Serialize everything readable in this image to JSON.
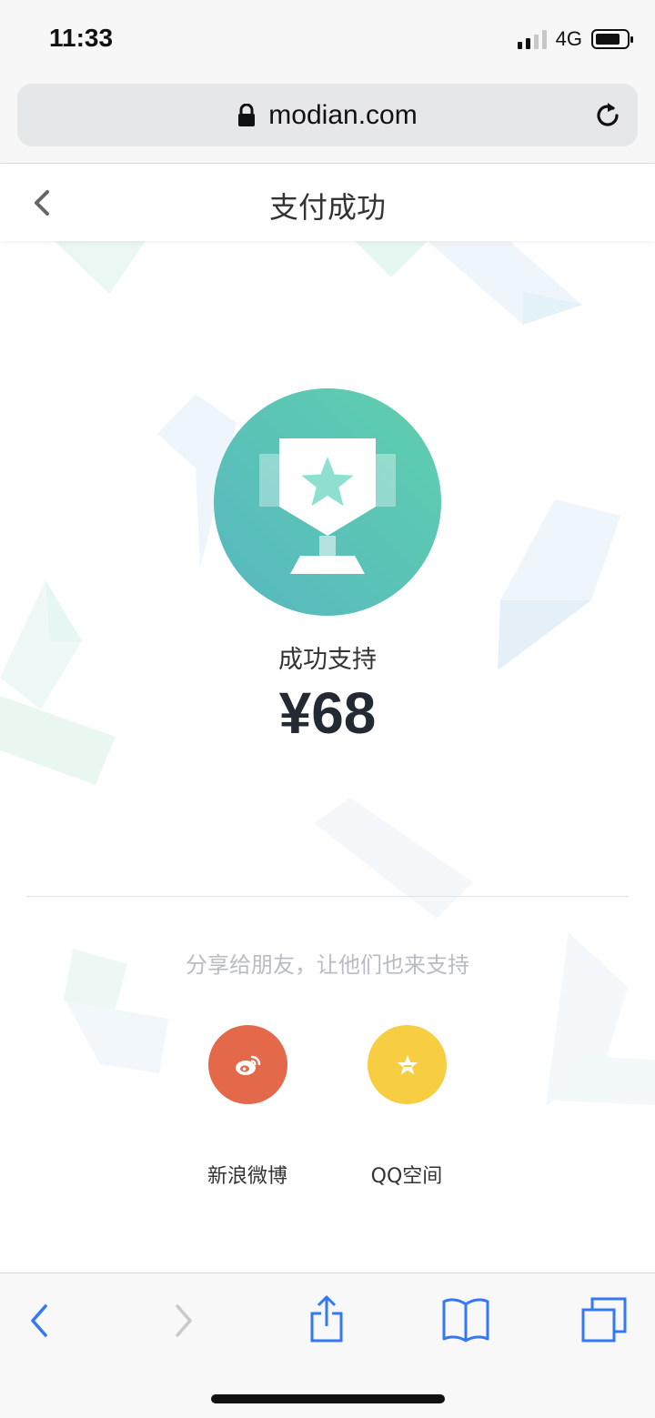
{
  "status": {
    "time": "11:33",
    "network": "4G"
  },
  "browser": {
    "url": "modian.com"
  },
  "header": {
    "title": "支付成功"
  },
  "main": {
    "success_label": "成功支持",
    "amount": "¥68",
    "share_hint": "分享给朋友，让他们也来支持"
  },
  "share": {
    "weibo_label": "新浪微博",
    "qzone_label": "QQ空间"
  },
  "colors": {
    "trophy_gradient_start": "#5fcfae",
    "trophy_gradient_end": "#57b8bf",
    "weibo": "#e4684a",
    "qzone": "#f7cd42",
    "safari_blue": "#3478f6"
  }
}
